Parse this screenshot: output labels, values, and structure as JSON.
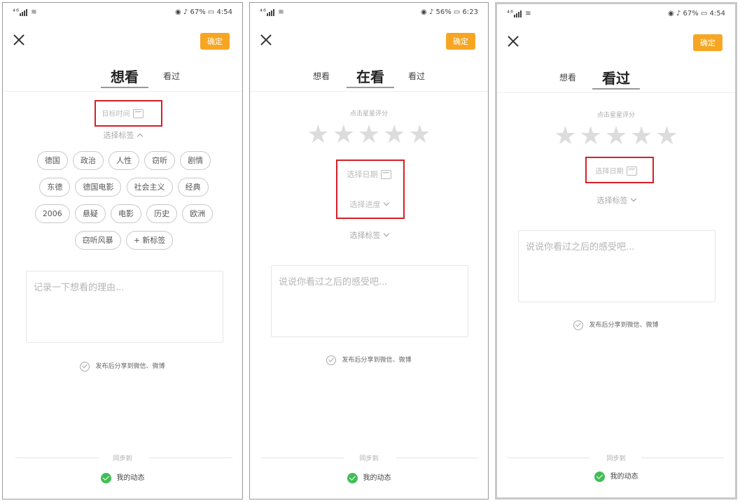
{
  "status_bars": [
    {
      "carrier": "⁴⁶",
      "battery": "67%",
      "time": "4:54"
    },
    {
      "carrier": "⁴⁶",
      "battery": "56%",
      "time": "6:23"
    },
    {
      "carrier": "⁴⁶",
      "battery": "67%",
      "time": "4:54"
    }
  ],
  "common": {
    "confirm_label": "确定",
    "share_label": "发布后分享到微信、微博",
    "sync_label": "同步到",
    "my_feed_label": "我的动态",
    "star_char": "★",
    "accent_color": "#f6a623",
    "check_color": "#42bd56",
    "highlight_color": "#d61f26"
  },
  "screen1": {
    "tabs": [
      {
        "label": "想看",
        "active": true
      },
      {
        "label": "看过",
        "active": false
      }
    ],
    "target_time_label": "目标时间",
    "choose_tags_label": "选择标签",
    "tags": [
      [
        "德国",
        "政治",
        "人性",
        "窃听",
        "剧情"
      ],
      [
        "东德",
        "德国电影",
        "社会主义",
        "经典"
      ],
      [
        "2006",
        "悬疑",
        "电影",
        "历史",
        "欧洲"
      ],
      [
        "窃听风暴",
        "+ 新标签"
      ]
    ],
    "note_placeholder": "记录一下想看的理由..."
  },
  "screen2": {
    "tabs": [
      {
        "label": "想看",
        "active": false
      },
      {
        "label": "在看",
        "active": true
      },
      {
        "label": "看过",
        "active": false
      }
    ],
    "rating_hint": "点击星星评分",
    "choose_date_label": "选择日期",
    "choose_progress_label": "选择进度",
    "choose_tags_label": "选择标签",
    "note_placeholder": "说说你看过之后的感受吧..."
  },
  "screen3": {
    "tabs": [
      {
        "label": "想看",
        "active": false
      },
      {
        "label": "看过",
        "active": true
      }
    ],
    "rating_hint": "点击星星评分",
    "choose_date_label": "选择日期",
    "choose_tags_label": "选择标签",
    "note_placeholder": "说说你看过之后的感受吧..."
  }
}
